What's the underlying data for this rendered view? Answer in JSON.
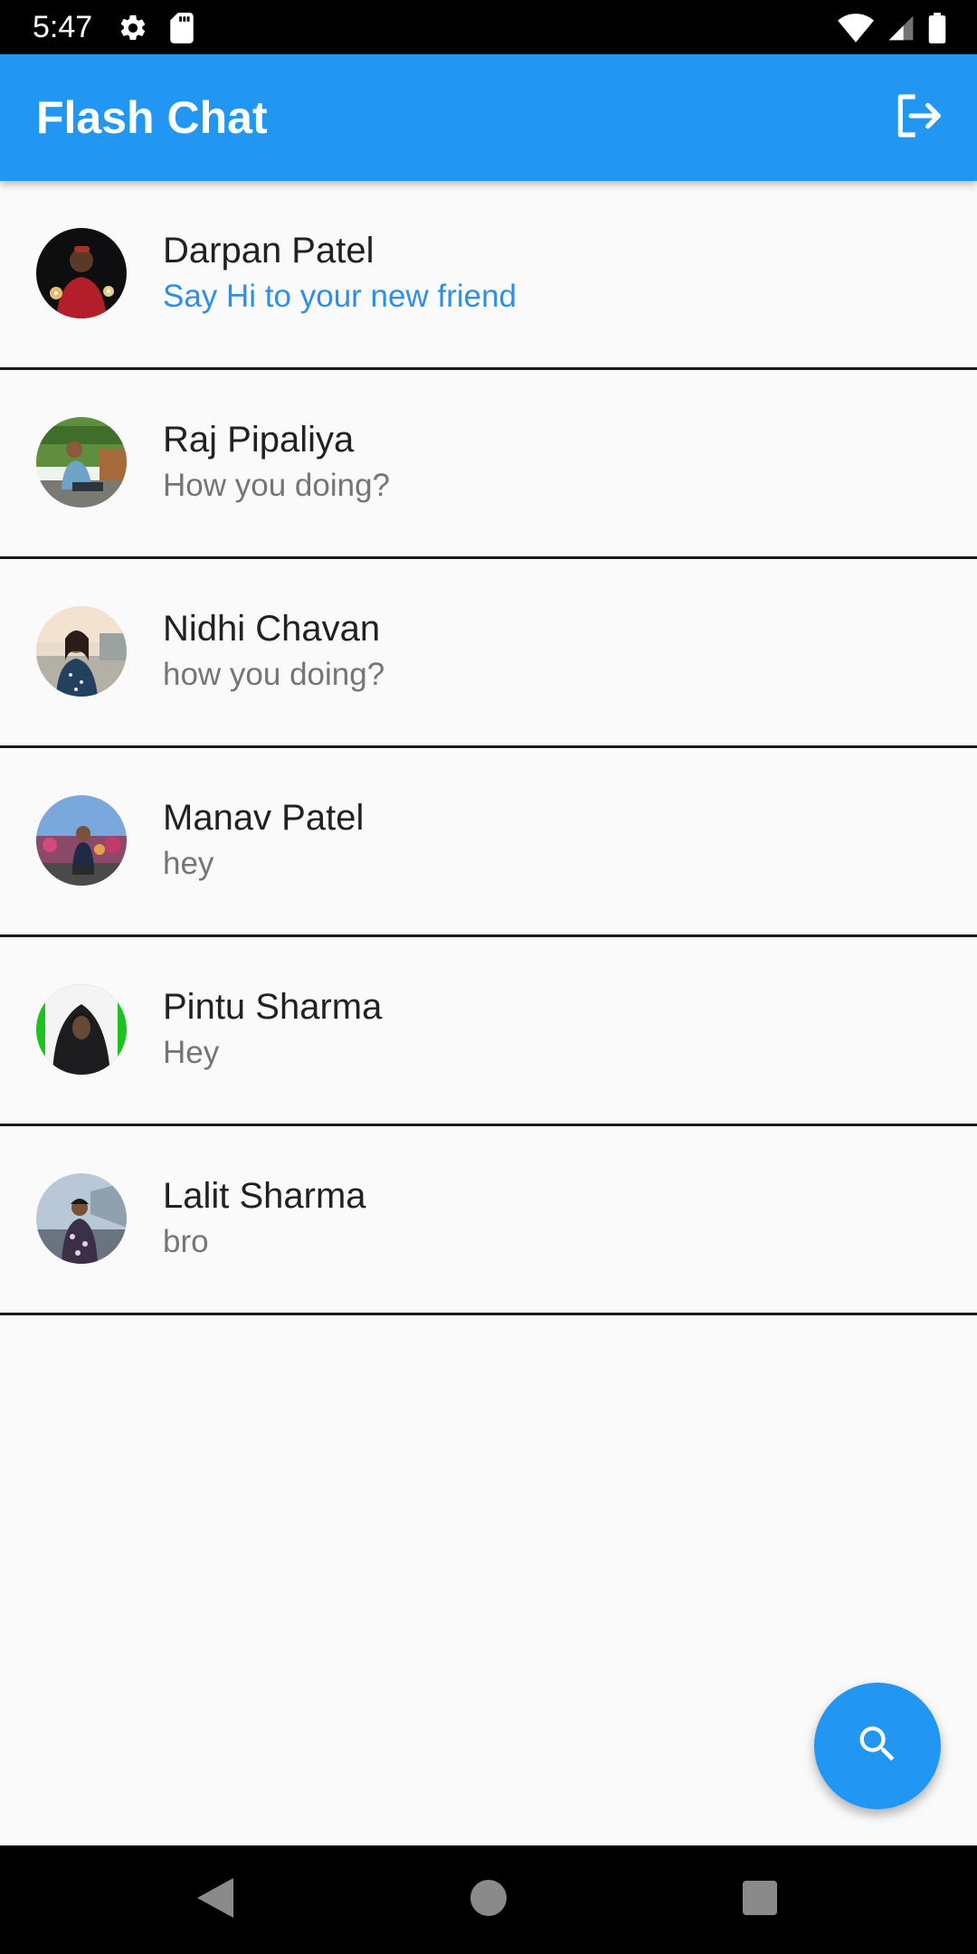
{
  "status_bar": {
    "time": "5:47",
    "left_icons": [
      "gear-icon",
      "sd-card-icon"
    ],
    "right_icons": [
      "wifi-icon",
      "cell-signal-icon",
      "battery-icon"
    ]
  },
  "app_bar": {
    "title": "Flash Chat",
    "action_icon": "logout-icon",
    "color": "#2196f3"
  },
  "chats": [
    {
      "name": "Darpan Patel",
      "message": "Say Hi to your new friend",
      "highlight": true
    },
    {
      "name": "Raj Pipaliya",
      "message": "How you doing?",
      "highlight": false
    },
    {
      "name": "Nidhi Chavan",
      "message": "how you doing?",
      "highlight": false
    },
    {
      "name": "Manav Patel",
      "message": "hey",
      "highlight": false
    },
    {
      "name": "Pintu Sharma",
      "message": "Hey",
      "highlight": false
    },
    {
      "name": "Lalit Sharma",
      "message": "bro",
      "highlight": false
    }
  ],
  "fab": {
    "icon": "search-icon"
  },
  "nav_bar": {
    "icons": [
      "back-icon",
      "home-icon",
      "recents-icon"
    ]
  },
  "colors": {
    "accent": "#2196f3",
    "new_message": "#2f8ee8",
    "divider": "#1a1a1a"
  }
}
